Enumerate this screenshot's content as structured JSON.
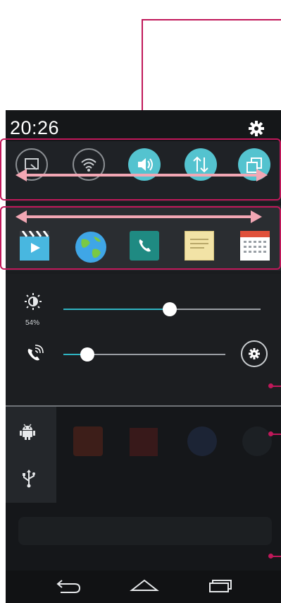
{
  "status_bar": {
    "time": "20:26",
    "settings_icon": "gear-icon"
  },
  "quick_settings": [
    {
      "name": "screen-mirror-icon",
      "state": "off"
    },
    {
      "name": "wifi-icon",
      "state": "off"
    },
    {
      "name": "sound-icon",
      "state": "on"
    },
    {
      "name": "data-icon",
      "state": "on"
    },
    {
      "name": "rotation-icon",
      "state": "on"
    }
  ],
  "qslide_apps": [
    "video-icon",
    "browser-icon",
    "phone-icon",
    "memo-icon",
    "calendar-icon"
  ],
  "brightness": {
    "label": "54%",
    "level": 0.54
  },
  "ringtone_volume": {
    "level": 0.15
  },
  "notifications": [
    "android-debug-icon",
    "usb-icon"
  ],
  "navigation": [
    "back-icon",
    "home-icon",
    "recent-apps-icon"
  ],
  "colors": {
    "accent": "#54c3cf",
    "annotation": "#c0185a",
    "panel": "#1a1c1f"
  }
}
